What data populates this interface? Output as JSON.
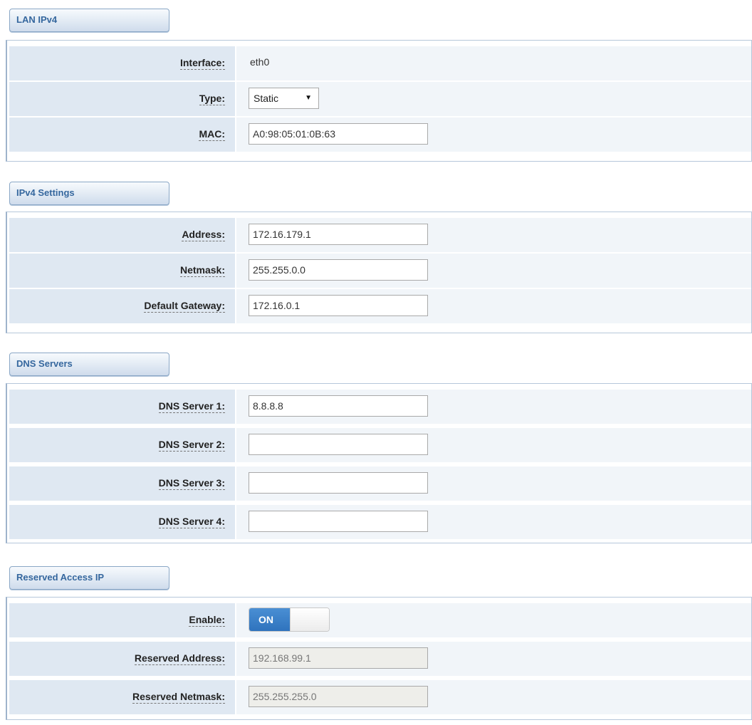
{
  "lan": {
    "title": "LAN IPv4",
    "interface_label": "Interface:",
    "interface_value": "eth0",
    "type_label": "Type:",
    "type_value": "Static",
    "mac_label": "MAC:",
    "mac_value": "A0:98:05:01:0B:63"
  },
  "ipv4": {
    "title": "IPv4 Settings",
    "address_label": "Address:",
    "address_value": "172.16.179.1",
    "netmask_label": "Netmask:",
    "netmask_value": "255.255.0.0",
    "gateway_label": "Default Gateway:",
    "gateway_value": "172.16.0.1"
  },
  "dns": {
    "title": "DNS Servers",
    "server1_label": "DNS Server 1:",
    "server1_value": "8.8.8.8",
    "server2_label": "DNS Server 2:",
    "server2_value": "",
    "server3_label": "DNS Server 3:",
    "server3_value": "",
    "server4_label": "DNS Server 4:",
    "server4_value": ""
  },
  "reserved": {
    "title": "Reserved Access IP",
    "enable_label": "Enable:",
    "enable_state": "ON",
    "address_label": "Reserved Address:",
    "address_value": "192.168.99.1",
    "netmask_label": "Reserved Netmask:",
    "netmask_value": "255.255.255.0"
  },
  "colors": {
    "section_title": "#35679e",
    "label_bg": "#dfe8f2",
    "value_bg": "#f1f5f9",
    "toggle_on": "#2f73bd"
  }
}
